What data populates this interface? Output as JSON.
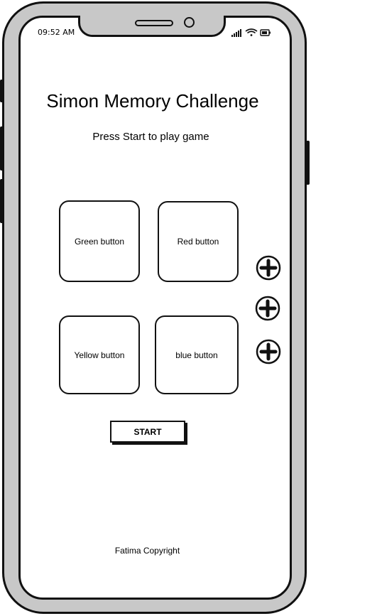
{
  "status_bar": {
    "time": "09:52 AM"
  },
  "header": {
    "title": "Simon Memory Challenge",
    "subtitle": "Press Start to play game"
  },
  "game_buttons": {
    "green": "Green button",
    "red": "Red button",
    "yellow": "Yellow button",
    "blue": "blue button"
  },
  "controls": {
    "start_label": "START"
  },
  "footer": {
    "text": "Fatima Copyright"
  },
  "icons": {
    "signal": "signal-icon",
    "wifi": "wifi-icon",
    "battery": "battery-icon",
    "add": "plus-circle-icon"
  }
}
